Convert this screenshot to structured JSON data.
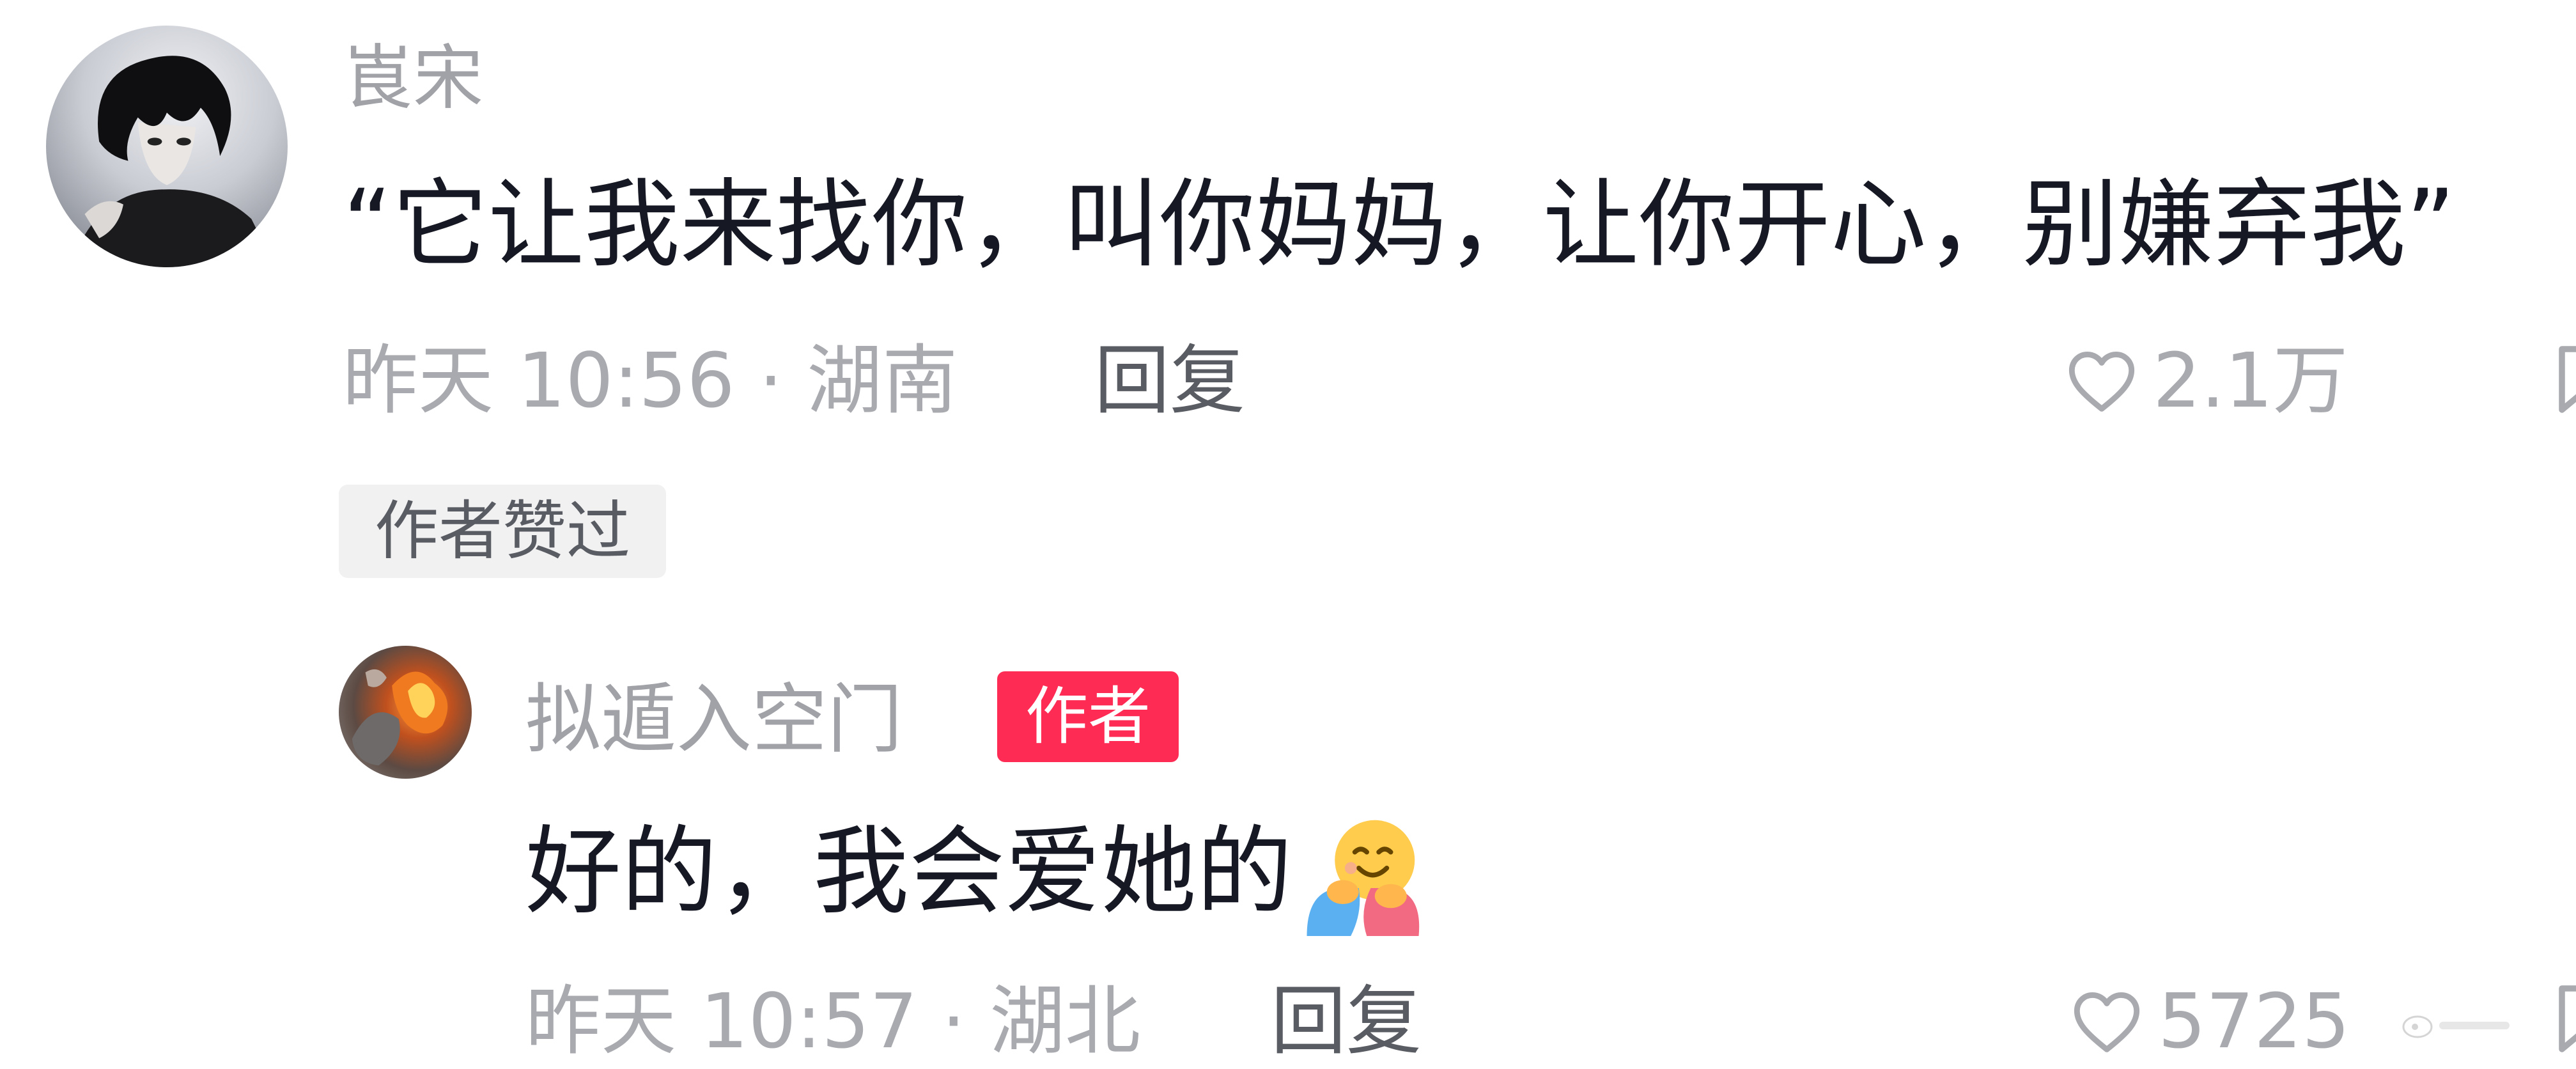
{
  "main_comment": {
    "username": "崀宋",
    "text": "“它让我来找你，叫你妈妈，让你开心，别嫌弃我”",
    "meta": "昨天 10:56 · 湖南",
    "reply_label": "回复",
    "like_count": "2.1万",
    "badge": "作者赞过",
    "icons": {
      "avatar": "anime-boy-avatar",
      "like": "heart-outline-icon",
      "more": "comment-icon"
    }
  },
  "reply_comment": {
    "username": "拟遁入空门",
    "author_badge": "作者",
    "text": "好的，我会爱她的",
    "emoji": "hugging-face-emoji",
    "meta": "昨天 10:57 · 湖北",
    "reply_label": "回复",
    "like_count": "5725",
    "icons": {
      "avatar": "fire-cat-avatar",
      "like": "heart-outline-icon",
      "more": "comment-icon"
    }
  },
  "colors": {
    "text_primary": "#161823",
    "text_secondary": "#a8aaaf",
    "author_badge_bg": "#fe2c55",
    "liked_badge_bg": "#f1f1f2"
  }
}
